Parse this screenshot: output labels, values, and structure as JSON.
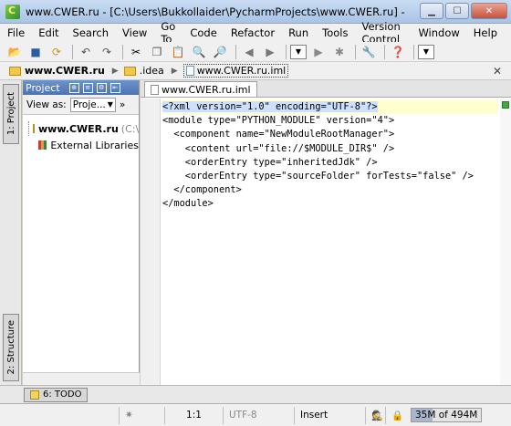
{
  "window": {
    "title": "www.CWER.ru - [C:\\Users\\Bukkollaider\\PycharmProjects\\www.CWER.ru] - ...\\.idea\\www.CWER.ru.iml - PyCharm"
  },
  "menu": [
    "File",
    "Edit",
    "Search",
    "View",
    "Go To",
    "Code",
    "Refactor",
    "Run",
    "Tools",
    "Version Control",
    "Window",
    "Help"
  ],
  "toolbar": [
    "open-icon",
    "save-icon",
    "sync-icon",
    "undo-icon",
    "redo-icon",
    "cut-icon",
    "copy-icon",
    "paste-icon",
    "find-icon",
    "replace-icon",
    "back-icon",
    "forward-icon",
    "run-icon",
    "debug-icon",
    "settings-icon",
    "help-icon"
  ],
  "navbar": {
    "crumbs": [
      "www.CWER.ru",
      ".idea",
      "www.CWER.ru.iml"
    ]
  },
  "sidebar": {
    "project_tab": "1: Project",
    "structure_tab": "2: Structure"
  },
  "project": {
    "header": "Project",
    "view_as_label": "View as:",
    "view_as_value": "Proje...",
    "tree": [
      {
        "label": "www.CWER.ru",
        "suffix": "(C:\\"
      },
      {
        "label": "External Libraries"
      }
    ]
  },
  "editor": {
    "tab": "www.CWER.ru.iml",
    "lines": [
      "<?xml version=\"1.0\" encoding=\"UTF-8\"?>",
      "<module type=\"PYTHON_MODULE\" version=\"4\">",
      "  <component name=\"NewModuleRootManager\">",
      "    <content url=\"file://$MODULE_DIR$\" />",
      "    <orderEntry type=\"inheritedJdk\" />",
      "    <orderEntry type=\"sourceFolder\" forTests=\"false\" />",
      "  </component>",
      "</module>"
    ]
  },
  "bottom": {
    "todo_tab": "6: TODO"
  },
  "status": {
    "position": "1:1",
    "encoding": "UTF-8",
    "mode": "Insert",
    "memory": "35M of 494M"
  },
  "colors": {
    "title_bar": "#c9dcf2",
    "project_header": "#4a74b5",
    "caret_line": "#ffffd0"
  }
}
